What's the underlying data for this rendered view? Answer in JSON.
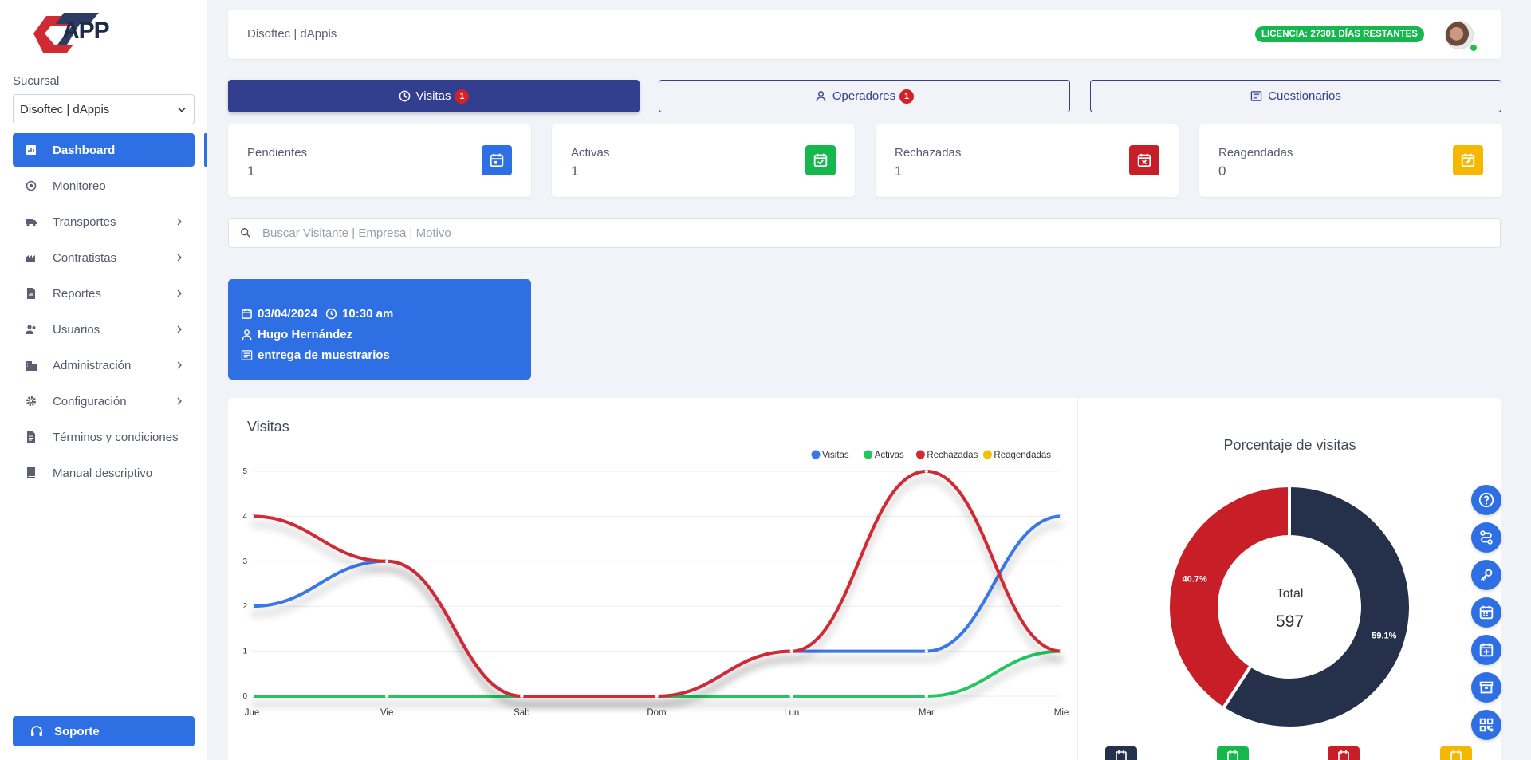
{
  "app": {
    "logo_text": "APP"
  },
  "sidebar": {
    "branch_label": "Sucursal",
    "branch_value": "Disoftec | dAppis",
    "items": [
      {
        "label": "Dashboard",
        "icon": "chart-bar-icon",
        "active": true,
        "has_arrow": false
      },
      {
        "label": "Monitoreo",
        "icon": "monitor-eye-icon",
        "active": false,
        "has_arrow": false
      },
      {
        "label": "Transportes",
        "icon": "truck-icon",
        "active": false,
        "has_arrow": true
      },
      {
        "label": "Contratistas",
        "icon": "industry-icon",
        "active": false,
        "has_arrow": true
      },
      {
        "label": "Reportes",
        "icon": "report-file-icon",
        "active": false,
        "has_arrow": true
      },
      {
        "label": "Usuarios",
        "icon": "users-icon",
        "active": false,
        "has_arrow": true
      },
      {
        "label": "Administración",
        "icon": "building-icon",
        "active": false,
        "has_arrow": true
      },
      {
        "label": "Configuración",
        "icon": "gear-icon",
        "active": false,
        "has_arrow": true
      },
      {
        "label": "Términos y condiciones",
        "icon": "document-icon",
        "active": false,
        "has_arrow": false
      },
      {
        "label": "Manual descriptivo",
        "icon": "book-icon",
        "active": false,
        "has_arrow": false
      }
    ],
    "support_label": "Soporte"
  },
  "header": {
    "brand": "Disoftec | dAppis",
    "license": "LICENCIA: 27301 DÍAS RESTANTES"
  },
  "tabs": [
    {
      "label": "Visitas",
      "badge": "1",
      "active": true,
      "icon": "clock-icon"
    },
    {
      "label": "Operadores",
      "badge": "1",
      "active": false,
      "icon": "user-icon"
    },
    {
      "label": "Cuestionarios",
      "badge": "",
      "active": false,
      "icon": "list-icon"
    }
  ],
  "stats": [
    {
      "label": "Pendientes",
      "value": "1",
      "color": "#2f6fe4",
      "icon": "calendar-icon"
    },
    {
      "label": "Activas",
      "value": "1",
      "color": "#16b84e",
      "icon": "calendar-check-icon"
    },
    {
      "label": "Rechazadas",
      "value": "1",
      "color": "#c81e27",
      "icon": "calendar-x-icon"
    },
    {
      "label": "Reagendadas",
      "value": "0",
      "color": "#f5b800",
      "icon": "calendar-edit-icon"
    }
  ],
  "search": {
    "placeholder": "Buscar Visitante | Empresa | Motivo"
  },
  "visit_card": {
    "date": "03/04/2024",
    "time": "10:30 am",
    "person": "Hugo Hernández",
    "reason": "entrega de muestrarios"
  },
  "line_chart": {
    "title": "Visitas"
  },
  "pie_chart": {
    "title": "Porcentaje de visitas",
    "center_label": "Total",
    "center_value": "597"
  },
  "fabs": [
    "help-icon",
    "route-icon",
    "key-icon",
    "calendar-grid-icon",
    "calendar-plus-icon",
    "archive-icon",
    "qr-icon"
  ],
  "mini_icons": [
    {
      "icon": "calendar-icon",
      "color": "#25314a"
    },
    {
      "icon": "calendar-check-icon",
      "color": "#16b84e"
    },
    {
      "icon": "calendar-x-icon",
      "color": "#c81e27"
    },
    {
      "icon": "calendar-edit-icon",
      "color": "#f5b800"
    }
  ],
  "chart_data": [
    {
      "type": "line",
      "title": "Visitas",
      "categories": [
        "Jue",
        "Vie",
        "Sab",
        "Dom",
        "Lun",
        "Mar",
        "Mie"
      ],
      "ylim": [
        0,
        5
      ],
      "yticks": [
        0,
        1,
        2,
        3,
        4,
        5
      ],
      "legend_position": "top-right",
      "grid": true,
      "series": [
        {
          "name": "Visitas",
          "color": "#3b78e7",
          "values": [
            2,
            3,
            0,
            0,
            1,
            1,
            4
          ]
        },
        {
          "name": "Activas",
          "color": "#22c55e",
          "values": [
            0,
            0,
            0,
            0,
            0,
            0,
            1
          ]
        },
        {
          "name": "Rechazadas",
          "color": "#d12a35",
          "values": [
            4,
            3,
            0,
            0,
            1,
            5,
            1
          ]
        },
        {
          "name": "Reagendadas",
          "color": "#f5c000",
          "values": [
            0,
            0,
            0,
            0,
            0,
            0,
            0
          ]
        }
      ]
    },
    {
      "type": "pie",
      "title": "Porcentaje de visitas",
      "slices": [
        {
          "value": 59.1,
          "label": "59.1%",
          "color": "#25314a"
        },
        {
          "value": 40.7,
          "label": "40.7%",
          "color": "#c81e27"
        }
      ]
    }
  ]
}
